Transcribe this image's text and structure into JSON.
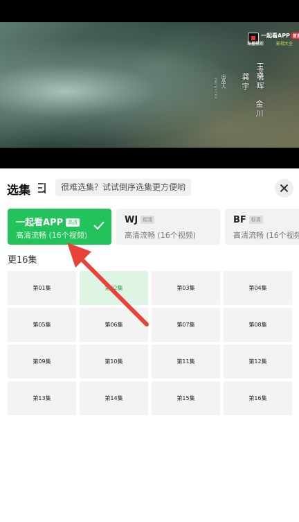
{
  "video": {
    "watermark": {
      "app_name": "一起看APP",
      "badge": "首发",
      "line1": "海量精彩",
      "line2": "影视大全",
      "seal": "一起看"
    },
    "credits": [
      {
        "text": "出品人",
        "size": "small"
      },
      {
        "text": "PRODUCER",
        "size": "tiny"
      },
      {
        "text": "龚宇",
        "size": "big"
      },
      {
        "text": "总监制",
        "size": "small"
      },
      {
        "text": "王晓晖",
        "size": "big"
      },
      {
        "text": "金川",
        "size": "big"
      }
    ]
  },
  "sheet": {
    "title": "选集",
    "hint": "很难选集？试试倒序选集更方便哟"
  },
  "sources": [
    {
      "name": "一起看APP",
      "tag": "高清",
      "desc": "高清流畅 (16个视频)",
      "active": true
    },
    {
      "name": "WJ",
      "tag": "标清",
      "desc": "高清流畅 (16个视频)",
      "active": false
    },
    {
      "name": "BF",
      "tag": "标清",
      "desc": "高清流畅 (16个视频)",
      "active": false
    }
  ],
  "update_label": "更16集",
  "current_episode": 1,
  "episodes": [
    "第01集",
    "第02集",
    "第03集",
    "第04集",
    "第05集",
    "第06集",
    "第07集",
    "第08集",
    "第09集",
    "第10集",
    "第11集",
    "第12集",
    "第13集",
    "第14集",
    "第15集",
    "第16集"
  ],
  "colors": {
    "accent": "#22c35a",
    "arrow": "#e8413a",
    "current_bg": "#dff5e4"
  },
  "icons": {
    "close": "close-icon",
    "sort": "reverse-sort-icon",
    "check": "check-icon"
  }
}
